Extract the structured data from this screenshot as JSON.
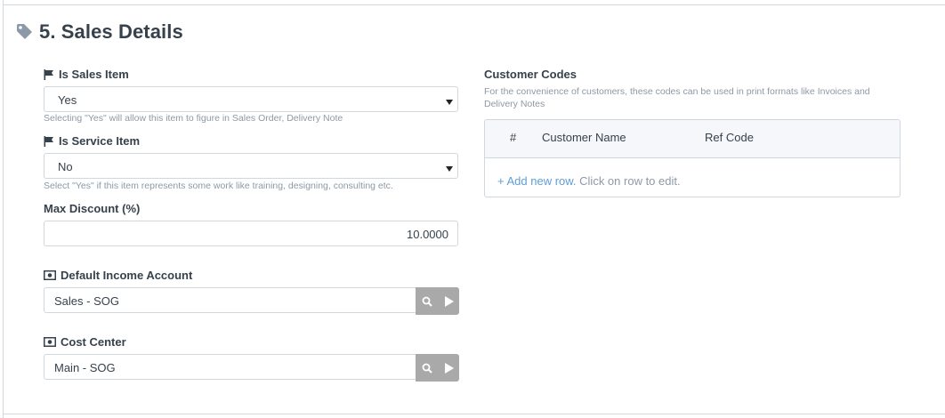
{
  "section": {
    "icon": "tag-icon",
    "title": "5. Sales Details"
  },
  "fields": {
    "is_sales_item": {
      "icon": "flag-icon",
      "label": "Is Sales Item",
      "value": "Yes",
      "help": "Selecting \"Yes\" will allow this item to figure in Sales Order, Delivery Note"
    },
    "is_service_item": {
      "icon": "flag-icon",
      "label": "Is Service Item",
      "value": "No",
      "help": "Select \"Yes\" if this item represents some work like training, designing, consulting etc."
    },
    "max_discount": {
      "label": "Max Discount (%)",
      "value": "10.0000"
    },
    "default_income_account": {
      "icon": "money-icon",
      "label": "Default Income Account",
      "value": "Sales - SOG"
    },
    "cost_center": {
      "icon": "money-icon",
      "label": "Cost Center",
      "value": "Main - SOG"
    }
  },
  "customer_codes": {
    "title": "Customer Codes",
    "description": "For the convenience of customers, these codes can be used in print formats like Invoices and Delivery Notes",
    "columns": [
      "#",
      "Customer Name",
      "Ref Code"
    ],
    "add_row": "+ Add new row.",
    "hint": "Click on row to edit."
  },
  "colors": {
    "text": "#36414c",
    "muted": "#8d99a6",
    "border": "#d1d8dd",
    "link": "#5e9ed6",
    "link_button_bg": "#a9a9a9"
  }
}
